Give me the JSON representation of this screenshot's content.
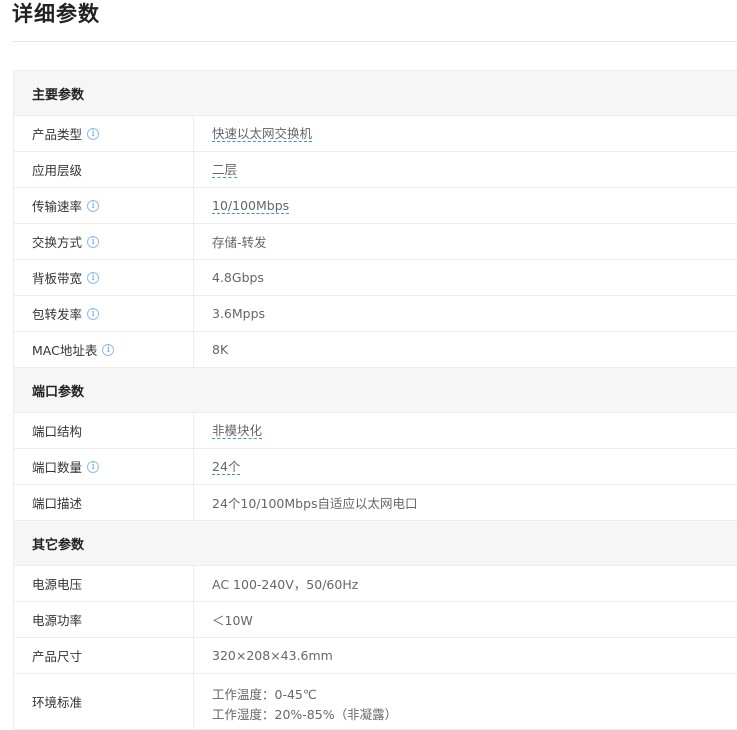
{
  "page": {
    "title": "详细参数"
  },
  "sections": [
    {
      "title": "主要参数",
      "rows": [
        {
          "label": "产品类型",
          "value": "快速以太网交换机",
          "info": true,
          "linked": true
        },
        {
          "label": "应用层级",
          "value": "二层",
          "info": false,
          "linked": true
        },
        {
          "label": "传输速率",
          "value": "10/100Mbps",
          "info": true,
          "linked": true
        },
        {
          "label": "交换方式",
          "value": "存储-转发",
          "info": true,
          "linked": false
        },
        {
          "label": "背板带宽",
          "value": "4.8Gbps",
          "info": true,
          "linked": false
        },
        {
          "label": "包转发率",
          "value": "3.6Mpps",
          "info": true,
          "linked": false
        },
        {
          "label": "MAC地址表",
          "value": "8K",
          "info": true,
          "linked": false
        }
      ]
    },
    {
      "title": "端口参数",
      "rows": [
        {
          "label": "端口结构",
          "value": "非模块化",
          "info": false,
          "linked": true
        },
        {
          "label": "端口数量",
          "value": "24个",
          "info": true,
          "linked": true
        },
        {
          "label": "端口描述",
          "value": "24个10/100Mbps自适应以太网电口",
          "info": false,
          "linked": false
        }
      ]
    },
    {
      "title": "其它参数",
      "rows": [
        {
          "label": "电源电压",
          "value": "AC 100-240V，50/60Hz",
          "info": false,
          "linked": false
        },
        {
          "label": "电源功率",
          "value": "＜10W",
          "info": false,
          "linked": false
        },
        {
          "label": "产品尺寸",
          "value": "320×208×43.6mm",
          "info": false,
          "linked": false
        },
        {
          "label": "环境标准",
          "value_lines": [
            "工作温度：0-45℃",
            "工作湿度：20%-85%（非凝露）"
          ],
          "info": false,
          "linked": false
        }
      ]
    }
  ],
  "icons": {
    "info": "info-circle-icon",
    "info_glyph": "i"
  },
  "colors": {
    "info_icon": "#5a9ee8",
    "link_underline": "#3a8ee6",
    "section_bg": "#f6f6f6"
  }
}
